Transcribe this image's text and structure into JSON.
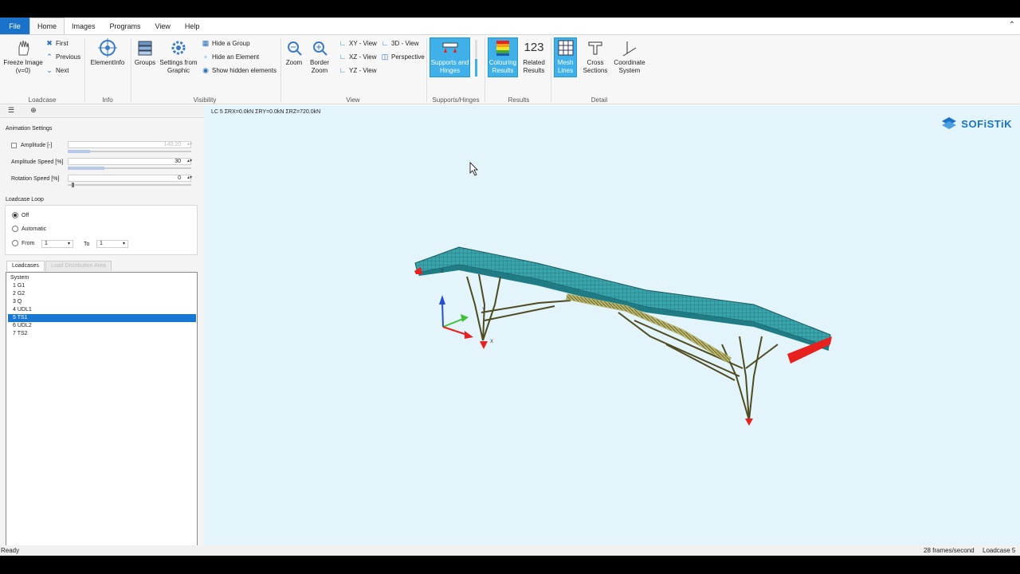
{
  "menu": {
    "file": "File",
    "tabs": [
      "Home",
      "Images",
      "Programs",
      "View",
      "Help"
    ],
    "active_tab": "Home"
  },
  "ribbon": {
    "loadcase": {
      "freeze_image": "Freeze Image",
      "freeze_sub": "(v=0)",
      "first": "First",
      "previous": "Previous",
      "next": "Next",
      "group_label": "Loadcase"
    },
    "info": {
      "element_info": "ElementInfo",
      "group_label": "Info"
    },
    "visibility": {
      "groups": "Groups",
      "settings_from": "Settings from",
      "graphic": "Graphic",
      "hide_group": "Hide a Group",
      "hide_element": "Hide an Element",
      "show_hidden": "Show hidden elements",
      "group_label": "Visibility"
    },
    "view": {
      "zoom": "Zoom",
      "border": "Border",
      "border_zoom": "Zoom",
      "xy": "XY - View",
      "xz": "XZ - View",
      "yz": "YZ - View",
      "threed": "3D - View",
      "perspective": "Perspective",
      "group_label": "View"
    },
    "supports": {
      "line1": "Supports and",
      "line2": "Hinges",
      "group_label": "Supports/Hinges"
    },
    "results": {
      "colouring1": "Colouring",
      "colouring2": "Results",
      "related_icon": "123",
      "related1": "Related",
      "related2": "Results",
      "group_label": "Results"
    },
    "detail": {
      "mesh1": "Mesh",
      "mesh2": "Lines",
      "cross1": "Cross",
      "cross2": "Sections",
      "coord1": "Coordinate",
      "coord2": "System",
      "group_label": "Detail"
    }
  },
  "left_panel": {
    "animation_settings": "Animation Settings",
    "amplitude": "Amplitude [-]",
    "amplitude_value": "140.20",
    "amplitude_speed": "Amplitude Speed [%]",
    "amplitude_speed_value": "30",
    "rotation_speed": "Rotation Speed [%]",
    "rotation_speed_value": "0",
    "loadcase_loop": "Loadcase Loop",
    "off": "Off",
    "automatic": "Automatic",
    "from": "From",
    "from_value": "1",
    "to": "To",
    "to_value": "1",
    "tab_loadcases": "Loadcases",
    "tab_distribution": "Load Distribution Area",
    "items": [
      "System",
      "1 G1",
      "2 G2",
      "3 Q",
      "4 UDL1",
      "5 TS1",
      "6 UDL2",
      "7 TS2"
    ],
    "selected_index": 5
  },
  "viewport": {
    "header": "LC 5  ΣRX=0.0kN  ΣRY=0.0kN  ΣRZ=720.0kN",
    "logo": "SOFiSTiK",
    "axis_z": "Z",
    "axis_y": "Y",
    "axis_x": "X"
  },
  "status": {
    "ready": "Ready",
    "fps": "28 frames/second",
    "loadcase": "Loadcase 5"
  },
  "colors": {
    "accent": "#1a73c9",
    "selected_button": "#3fb0e8",
    "viewport_bg": "#e3f4fb",
    "deck": "#2aa3a8",
    "supports": "#e8201e"
  }
}
